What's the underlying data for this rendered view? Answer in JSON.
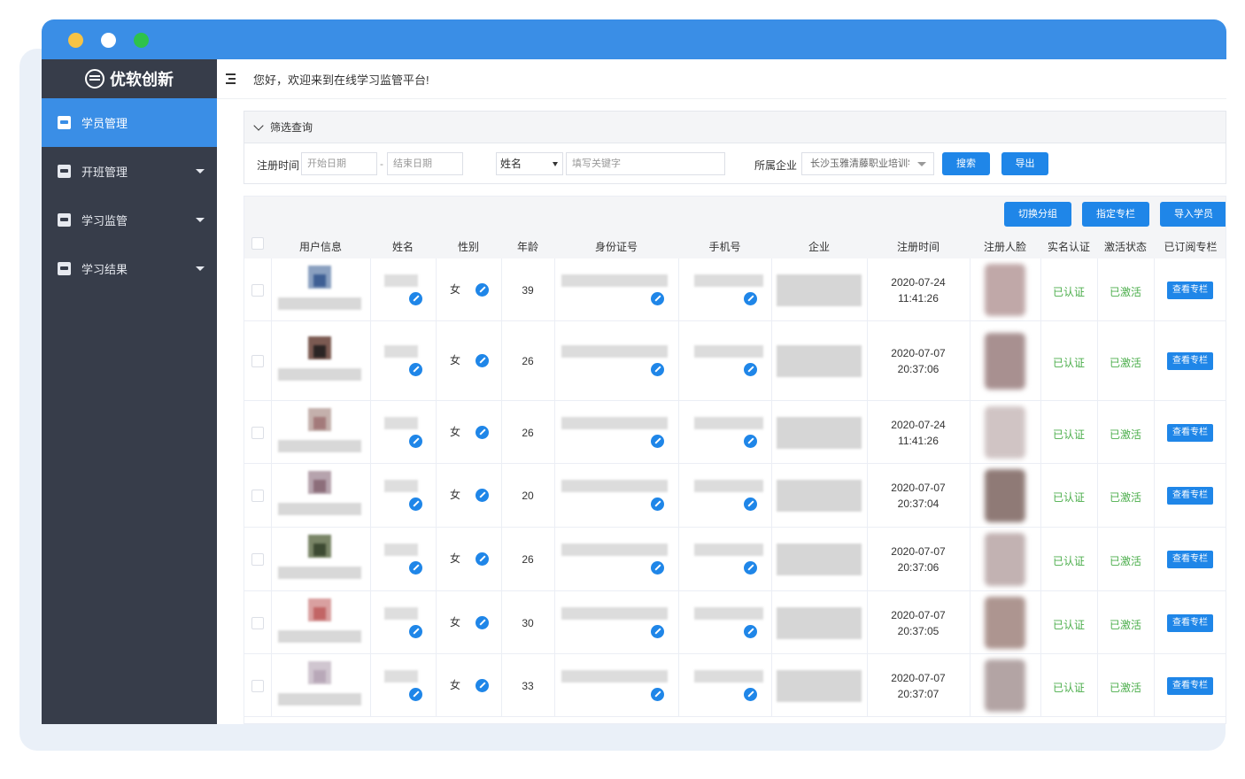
{
  "window": {
    "dots": [
      "#f7c344",
      "#ffffff",
      "#2ec24b"
    ],
    "accent": "#3a8ee6"
  },
  "sidebar": {
    "logo": "优软创新",
    "items": [
      {
        "label": "学员管理",
        "icon": "student-icon",
        "active": true
      },
      {
        "label": "开班管理",
        "icon": "class-icon",
        "active": false
      },
      {
        "label": "学习监管",
        "icon": "monitor-icon",
        "active": false
      },
      {
        "label": "学习结果",
        "icon": "result-icon",
        "active": false
      }
    ]
  },
  "header": {
    "greeting": "您好，欢迎来到在线学习监管平台!"
  },
  "filter": {
    "title": "筛选查询",
    "reg_time_label": "注册时间",
    "start_placeholder": "开始日期",
    "separator": "-",
    "end_placeholder": "结束日期",
    "field_select": "姓名",
    "keyword_placeholder": "填写关键字",
    "company_label": "所属企业",
    "company_value": "长沙玉雅清藤职业培训学校",
    "search_label": "搜索",
    "export_label": "导出"
  },
  "toolbar": {
    "switch_group": "切换分组",
    "assign_column": "指定专栏",
    "import_students": "导入学员"
  },
  "table": {
    "headers": [
      "用户信息",
      "姓名",
      "性别",
      "年龄",
      "身份证号",
      "手机号",
      "企业",
      "注册时间",
      "注册人脸",
      "实名认证",
      "激活状态",
      "已订阅专栏"
    ],
    "rows": [
      {
        "gender": "女",
        "age": "39",
        "date": "2020-07-24",
        "time": "11:41:26",
        "auth": "已认证",
        "status": "已激活",
        "action": "查看专栏"
      },
      {
        "gender": "女",
        "age": "26",
        "date": "2020-07-07",
        "time": "20:37:06",
        "auth": "已认证",
        "status": "已激活",
        "action": "查看专栏"
      },
      {
        "gender": "女",
        "age": "26",
        "date": "2020-07-24",
        "time": "11:41:26",
        "auth": "已认证",
        "status": "已激活",
        "action": "查看专栏"
      },
      {
        "gender": "女",
        "age": "20",
        "date": "2020-07-07",
        "time": "20:37:04",
        "auth": "已认证",
        "status": "已激活",
        "action": "查看专栏"
      },
      {
        "gender": "女",
        "age": "26",
        "date": "2020-07-07",
        "time": "20:37:06",
        "auth": "已认证",
        "status": "已激活",
        "action": "查看专栏"
      },
      {
        "gender": "女",
        "age": "30",
        "date": "2020-07-07",
        "time": "20:37:05",
        "auth": "已认证",
        "status": "已激活",
        "action": "查看专栏"
      },
      {
        "gender": "女",
        "age": "33",
        "date": "2020-07-07",
        "time": "20:37:07",
        "auth": "已认证",
        "status": "已激活",
        "action": "查看专栏"
      }
    ]
  }
}
